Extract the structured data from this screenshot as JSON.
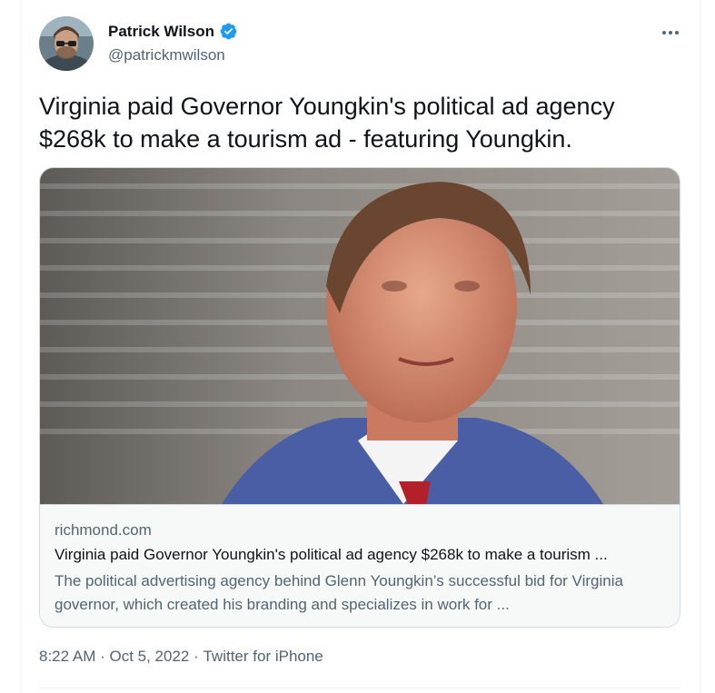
{
  "author": {
    "display_name": "Patrick Wilson",
    "handle": "@patrickmwilson",
    "verified_icon": "verified-badge-icon",
    "avatar_icon": "avatar"
  },
  "menu": {
    "more_icon": "more-icon"
  },
  "tweet": {
    "text": "Virginia paid Governor Youngkin's political ad agency $268k to make a tourism ad - featuring Youngkin."
  },
  "card": {
    "image_alt": "photo",
    "domain": "richmond.com",
    "title": "Virginia paid Governor Youngkin's political ad agency $268k to make a tourism ...",
    "description": "The political advertising agency behind Glenn Youngkin’s successful bid for Virginia governor, which created his branding and specializes in work for ..."
  },
  "meta": {
    "time": "8:22 AM",
    "separator": " · ",
    "date": "Oct 5, 2022",
    "source": "Twitter for iPhone"
  },
  "colors": {
    "primary_text": "#0f1419",
    "secondary_text": "#536471",
    "verified_blue": "#1d9bf0",
    "border": "#cfd9de"
  }
}
